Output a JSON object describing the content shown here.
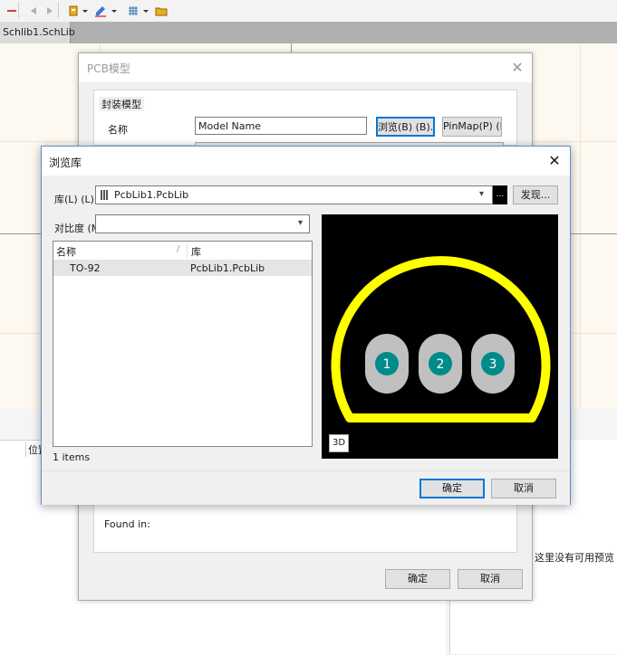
{
  "tab": {
    "label": "Schlib1.SchLib"
  },
  "bottom_panel": {
    "column_header": "位置",
    "no_preview_text": "这里没有可用预览"
  },
  "pcb_dialog": {
    "title": "PCB模型",
    "group_title": "封装模型",
    "name_label": "名称",
    "model_name_value": "Model Name",
    "browse_button": "浏览(B) (B)...",
    "pinmap_button": "PinMap(P) (P)...",
    "found_in_label": "Found in:",
    "ok_button": "确定",
    "cancel_button": "取消"
  },
  "browse_dialog": {
    "title": "浏览库",
    "library_label": "库(L) (L)",
    "library_value": "PcbLib1.PcbLib",
    "dots_button": "...",
    "discover_button": "发现...",
    "compare_label": "对比度 (M",
    "compare_value": "",
    "columns": {
      "name": "名称",
      "library": "库"
    },
    "rows": [
      {
        "name": "TO-92",
        "library": "PcbLib1.PcbLib"
      }
    ],
    "items_count": "1 items",
    "preview": {
      "pads": [
        "1",
        "2",
        "3"
      ],
      "outline_color": "#ffff00",
      "pad_color": "#c0c0c0",
      "pad_center_color": "#008b8b"
    },
    "btn_3d": "3D",
    "ok_button": "确定",
    "cancel_button": "取消"
  }
}
